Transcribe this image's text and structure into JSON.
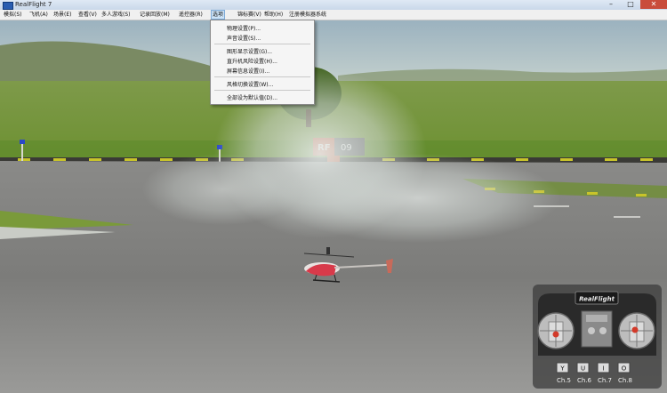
{
  "window": {
    "title": "RealFlight 7",
    "minimize_glyph": "–",
    "maximize_glyph": "□",
    "close_glyph": "✕"
  },
  "menubar": {
    "items": [
      {
        "label": "模拟(S)"
      },
      {
        "label": "飞机(A)"
      },
      {
        "label": "场景(E)"
      },
      {
        "label": "查看(V)"
      },
      {
        "label": "多人游戏(S)"
      },
      {
        "label": "记录回放(M)"
      },
      {
        "label": "遥控器(R)"
      },
      {
        "label": "选项"
      },
      {
        "label": "锦标赛(V)"
      },
      {
        "label": "帮助(H)"
      },
      {
        "label": "注册模拟器系统"
      }
    ]
  },
  "dropdown": {
    "items": [
      {
        "label": "物理设置(P)..."
      },
      {
        "label": "声音设置(S)..."
      },
      {
        "label": "图形显示设置(G)..."
      },
      {
        "label": "直升机风险设置(H)..."
      },
      {
        "label": "屏幕信息设置(I)..."
      },
      {
        "label": "风格切换设置(W)..."
      },
      {
        "label": "全部设为默认值(D)..."
      }
    ]
  },
  "scene": {
    "sign_letters": "RF",
    "sign_number": "09"
  },
  "transmitter": {
    "brand": "RealFlight",
    "channels": [
      {
        "key": "Y",
        "label": "Ch.5"
      },
      {
        "key": "U",
        "label": "Ch.6"
      },
      {
        "key": "I",
        "label": "Ch.7"
      },
      {
        "key": "O",
        "label": "Ch.8"
      }
    ]
  }
}
